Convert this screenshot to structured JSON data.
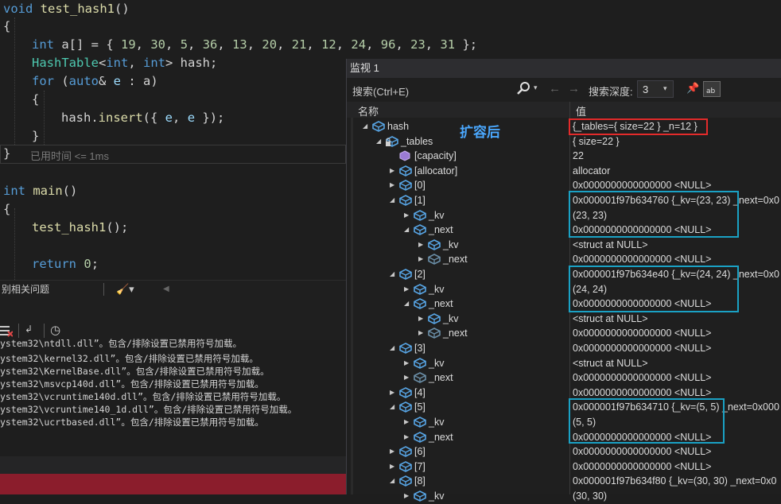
{
  "editor": {
    "lines": [
      "void test_hash1()",
      "{",
      "int a[] = { 19, 30, 5, 36, 13, 20, 21, 12, 24, 96, 23, 31 };",
      "HashTable<int, int> hash;",
      "for (auto& e : a)",
      "{",
      "hash.insert({ e, e });",
      "}",
      "}",
      "int main()",
      "{",
      "test_hash1();",
      "return 0;"
    ],
    "perf_tip": "已用时间 <= 1ms"
  },
  "output": {
    "title": "别相关问题",
    "lines": [
      "ystem32\\ntdll.dll”。包含/排除设置已禁用符号加载。",
      "ystem32\\kernel32.dll”。包含/排除设置已禁用符号加载。",
      "ystem32\\KernelBase.dll”。包含/排除设置已禁用符号加载。",
      "ystem32\\msvcp140d.dll”。包含/排除设置已禁用符号加载。",
      "ystem32\\vcruntime140d.dll”。包含/排除设置已禁用符号加载。",
      "ystem32\\vcruntime140_1d.dll”。包含/排除设置已禁用符号加载。",
      "ystem32\\ucrtbased.dll”。包含/排除设置已禁用符号加载。"
    ]
  },
  "watch": {
    "title": "监视 1",
    "search_placeholder": "搜索(Ctrl+E)",
    "depth_label": "搜索深度:",
    "depth_value": "3",
    "col_name": "名称",
    "col_value": "值",
    "annotation": "扩容后",
    "rows": [
      {
        "name": "hash",
        "value": "{_tables={ size=22 } _n=12 }"
      },
      {
        "name": "_tables",
        "value": "{ size=22 }"
      },
      {
        "name": "[capacity]",
        "value": "22"
      },
      {
        "name": "[allocator]",
        "value": "allocator"
      },
      {
        "name": "[0]",
        "value": "0x0000000000000000 <NULL>"
      },
      {
        "name": "[1]",
        "value": "0x000001f97b634760 {_kv=(23, 23) _next=0x0"
      },
      {
        "name": "_kv",
        "value": "(23, 23)"
      },
      {
        "name": "_next",
        "value": "0x0000000000000000 <NULL>"
      },
      {
        "name": "_kv",
        "value": "<struct at NULL>"
      },
      {
        "name": "_next",
        "value": "0x0000000000000000 <NULL>"
      },
      {
        "name": "[2]",
        "value": "0x000001f97b634e40 {_kv=(24, 24) _next=0x0"
      },
      {
        "name": "_kv",
        "value": "(24, 24)"
      },
      {
        "name": "_next",
        "value": "0x0000000000000000 <NULL>"
      },
      {
        "name": "_kv",
        "value": "<struct at NULL>"
      },
      {
        "name": "_next",
        "value": "0x0000000000000000 <NULL>"
      },
      {
        "name": "[3]",
        "value": "0x0000000000000000 <NULL>"
      },
      {
        "name": "_kv",
        "value": "<struct at NULL>"
      },
      {
        "name": "_next",
        "value": "0x0000000000000000 <NULL>"
      },
      {
        "name": "[4]",
        "value": "0x0000000000000000 <NULL>"
      },
      {
        "name": "[5]",
        "value": "0x000001f97b634710 {_kv=(5, 5) _next=0x000"
      },
      {
        "name": "_kv",
        "value": "(5, 5)"
      },
      {
        "name": "_next",
        "value": "0x0000000000000000 <NULL>"
      },
      {
        "name": "[6]",
        "value": "0x0000000000000000 <NULL>"
      },
      {
        "name": "[7]",
        "value": "0x0000000000000000 <NULL>"
      },
      {
        "name": "[8]",
        "value": "0x000001f97b634f80 {_kv=(30, 30) _next=0x0"
      },
      {
        "name": "_kv",
        "value": "(30, 30)"
      }
    ]
  },
  "colors": {
    "highlight_red": "#e32b2b",
    "highlight_cyan": "#1aa1c4",
    "annotation": "#4aa8ff",
    "status_bar": "#8b1d2c"
  }
}
